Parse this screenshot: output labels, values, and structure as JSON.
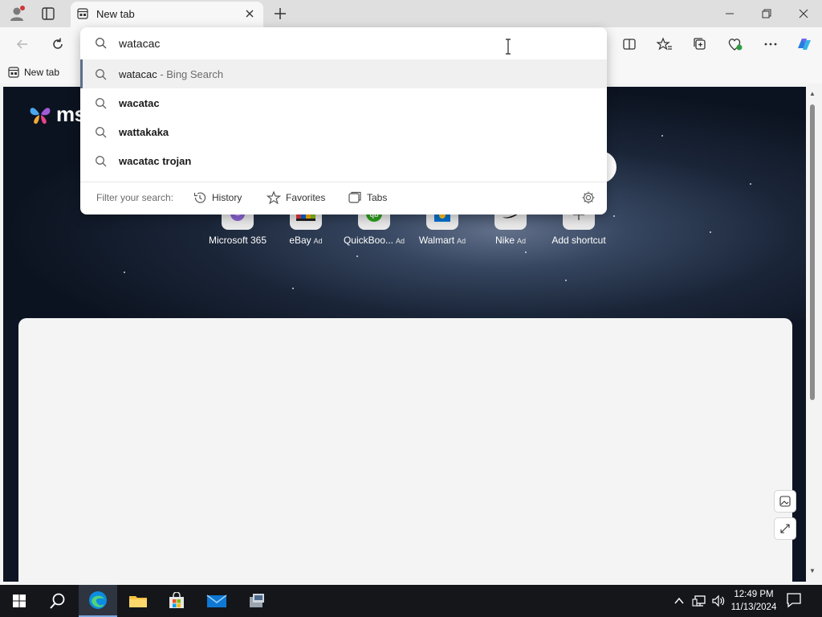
{
  "browser": {
    "tab": {
      "title": "New tab",
      "favicon": "newtab-icon"
    },
    "window_buttons": [
      "minimize-icon",
      "restore-icon",
      "close-icon"
    ],
    "favorites_bar": {
      "items": [
        {
          "label": "New tab",
          "icon": "newtab-icon"
        }
      ]
    }
  },
  "omnibox": {
    "value": "watacac",
    "suggestions": [
      {
        "text": "watacac",
        "suffix": " - Bing Search",
        "selected": true
      },
      {
        "text": "wacatac"
      },
      {
        "text": "wattakaka"
      },
      {
        "text": "wacatac trojan"
      }
    ],
    "filter": {
      "label": "Filter your search:",
      "options": [
        {
          "label": "History",
          "icon": "history-icon"
        },
        {
          "label": "Favorites",
          "icon": "star-icon"
        },
        {
          "label": "Tabs",
          "icon": "tabs-icon"
        }
      ]
    }
  },
  "newtab_page": {
    "brand": "ms",
    "shortcuts": [
      {
        "label": "Microsoft 365",
        "ad": ""
      },
      {
        "label": "eBay",
        "ad": "Ad"
      },
      {
        "label": "QuickBoo...",
        "ad": "Ad"
      },
      {
        "label": "Walmart",
        "ad": "Ad"
      },
      {
        "label": "Nike",
        "ad": "Ad"
      },
      {
        "label": "Add shortcut",
        "ad": ""
      }
    ]
  },
  "taskbar": {
    "apps": [
      "windows-start-icon",
      "search-icon",
      "edge-icon",
      "file-explorer-icon",
      "store-icon",
      "mail-icon",
      "app-icon"
    ],
    "clock": {
      "time": "12:49 PM",
      "date": "11/13/2024"
    }
  },
  "colors": {
    "accent": "#5b6f8a",
    "taskbar": "#14161a",
    "page_bg": "#0d1524"
  }
}
